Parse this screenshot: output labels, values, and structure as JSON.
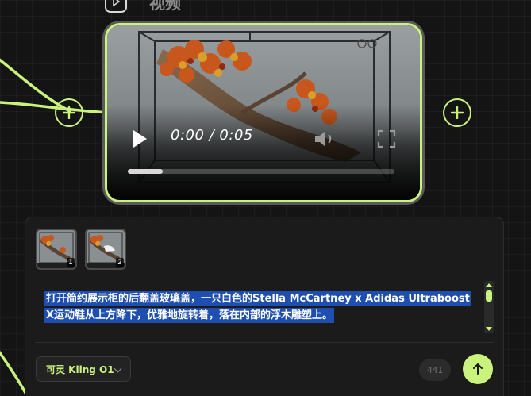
{
  "node": {
    "title": "视频",
    "icon": "video-node-icon"
  },
  "player": {
    "time": "0:00 / 0:05",
    "progress_fraction": 0.13,
    "icons": [
      "play-icon",
      "volume-icon",
      "fullscreen-icon"
    ]
  },
  "prompt": {
    "thumbnails": [
      {
        "badge": "1"
      },
      {
        "badge": "2"
      }
    ],
    "text": "打开简约展示柜的后翻盖玻璃盖，一只白色的Stella McCartney x Adidas Ultraboost X运动鞋从上方降下，优雅地旋转着，落在内部的浮木雕塑上。"
  },
  "toolbar": {
    "model_label": "可灵 Kling O1",
    "credits": "441"
  },
  "colors": {
    "accent": "#c9f37c",
    "selection": "#1e4fb0",
    "background": "#141414"
  }
}
